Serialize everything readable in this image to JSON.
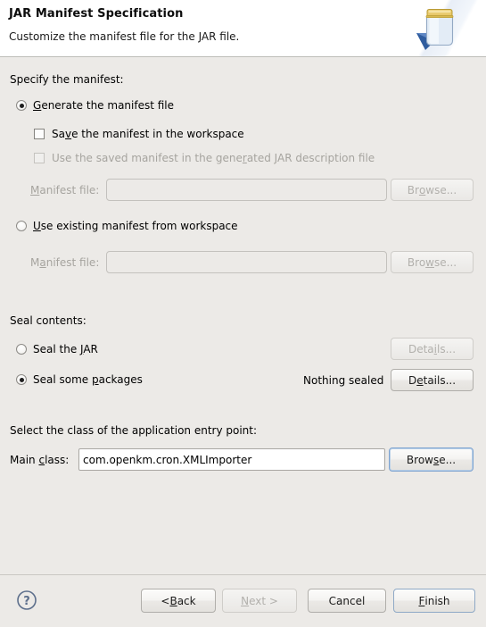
{
  "window": {
    "title": "JAR Manifest Specification",
    "description": "Customize the manifest file for the JAR file.",
    "icon": "jar-jar-icon",
    "accent_color": "#7fa4d0",
    "background_color": "#eceae7"
  },
  "manifest_section": {
    "group_label": "Specify the manifest:",
    "option_generate": {
      "label": "Generate the manifest file",
      "mnemonic": "G",
      "selected": true
    },
    "checkbox_save": {
      "label": "Save the manifest in the workspace",
      "mnemonic": "v",
      "checked": false,
      "enabled": true
    },
    "checkbox_use_saved": {
      "label": "Use the saved manifest in the generated JAR description file",
      "mnemonic": "r",
      "checked": false,
      "enabled": false
    },
    "manifest_file_generate": {
      "label": "Manifest file:",
      "mnemonic": "M",
      "value": "",
      "placeholder": "",
      "enabled": false,
      "browse_label": "Browse...",
      "browse_mnemonic": "o",
      "browse_enabled": false
    },
    "option_existing": {
      "label": "Use existing manifest from workspace",
      "mnemonic": "U",
      "selected": false
    },
    "manifest_file_existing": {
      "label": "Manifest file:",
      "mnemonic": "a",
      "value": "",
      "placeholder": "",
      "enabled": false,
      "browse_label": "Browse...",
      "browse_mnemonic": "w",
      "browse_enabled": false
    }
  },
  "seal_section": {
    "group_label": "Seal contents:",
    "option_seal_jar": {
      "label": "Seal the JAR",
      "mnemonic": "J",
      "selected": false,
      "details_label": "Details...",
      "details_mnemonic": "i",
      "details_enabled": false
    },
    "option_seal_packages": {
      "label": "Seal some packages",
      "mnemonic": "p",
      "selected": true,
      "status_text": "Nothing sealed",
      "details_label": "Details...",
      "details_mnemonic": "e",
      "details_enabled": true
    }
  },
  "entry_point_section": {
    "group_label": "Select the class of the application entry point:",
    "main_class": {
      "label": "Main class:",
      "mnemonic": "c",
      "value": "com.openkm.cron.XMLImporter",
      "placeholder": "",
      "enabled": true,
      "browse_label": "Browse...",
      "browse_mnemonic": "s",
      "browse_enabled": true,
      "browse_focused": true
    }
  },
  "footer": {
    "help_icon": "help-question-icon",
    "buttons": [
      {
        "id": "back",
        "label": "< Back",
        "mnemonic": "B",
        "enabled": true,
        "default": false
      },
      {
        "id": "next",
        "label": "Next >",
        "mnemonic": "N",
        "enabled": false,
        "default": false
      },
      {
        "id": "cancel",
        "label": "Cancel",
        "mnemonic": "",
        "enabled": true,
        "default": false
      },
      {
        "id": "finish",
        "label": "Finish",
        "mnemonic": "F",
        "enabled": true,
        "default": true
      }
    ]
  }
}
